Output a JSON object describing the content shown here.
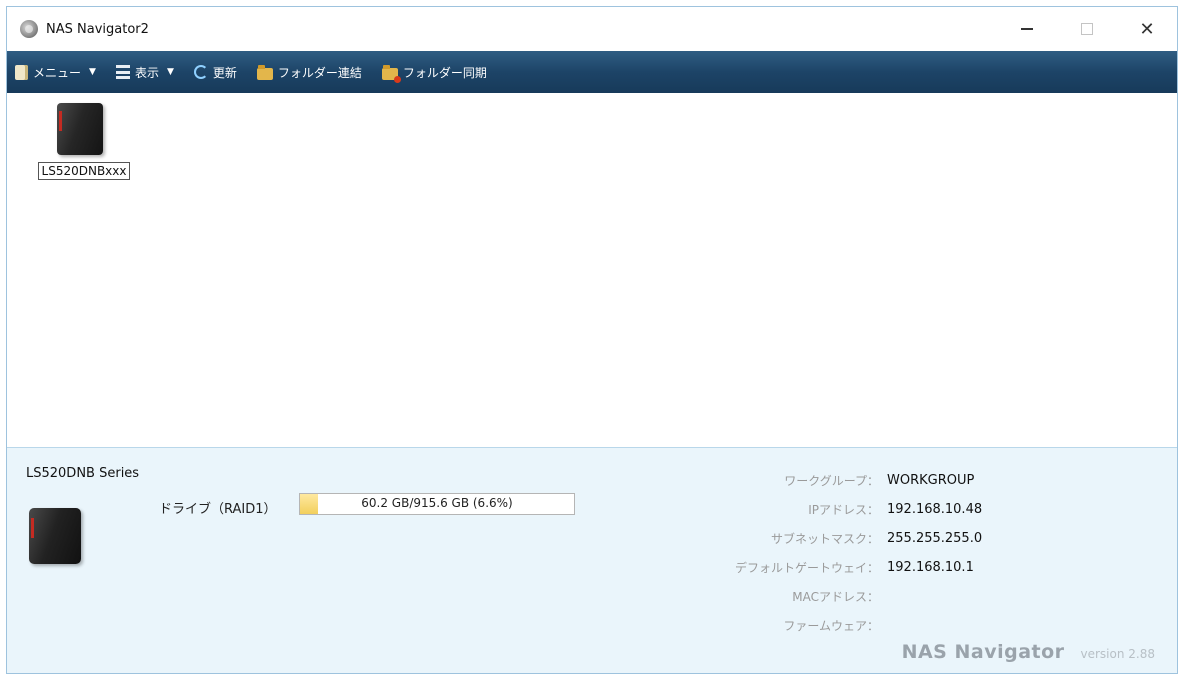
{
  "window": {
    "title": "NAS Navigator2",
    "controls": {
      "minimize": "–",
      "maximize": "☐",
      "close": "✕"
    }
  },
  "toolbar": {
    "items": [
      {
        "label": "メニュー",
        "icon": "menu-icon",
        "has_dropdown": true
      },
      {
        "label": "表示",
        "icon": "view-icon",
        "has_dropdown": true
      },
      {
        "label": "更新",
        "icon": "refresh-icon",
        "has_dropdown": false
      },
      {
        "label": "フォルダー連結",
        "icon": "folder-link-icon",
        "has_dropdown": false
      },
      {
        "label": "フォルダー同期",
        "icon": "folder-sync-icon",
        "has_dropdown": false
      }
    ],
    "dropdown_glyph": "▼"
  },
  "devices": [
    {
      "name": "LS520DNBxxx",
      "icon": "nas-device-icon",
      "selected": true
    }
  ],
  "info_panel": {
    "series": "LS520DNB Series",
    "drive": {
      "label": "ドライブ（RAID1）",
      "usage_text": "60.2 GB/915.6 GB (6.6%)",
      "used_percent": 6.6
    },
    "properties": [
      {
        "label": "ワークグループ：",
        "value": "WORKGROUP"
      },
      {
        "label": "IPアドレス：",
        "value": "192.168.10.48"
      },
      {
        "label": "サブネットマスク：",
        "value": "255.255.255.0"
      },
      {
        "label": "デフォルトゲートウェイ：",
        "value": "192.168.10.1"
      },
      {
        "label": "MACアドレス：",
        "value": ""
      },
      {
        "label": "ファームウェア：",
        "value": ""
      }
    ],
    "brand": {
      "name": "NAS Navigator",
      "version": "version 2.88"
    }
  },
  "colors": {
    "toolbar_bg": "#1d4467",
    "info_bg": "#eaf5fb",
    "drive_fill": "#f2cf5c",
    "nas_led": "#c42b22"
  }
}
